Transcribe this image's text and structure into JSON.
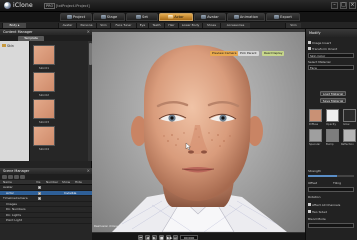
{
  "titlebar": {
    "app_name": "iClone",
    "edition": "PRO",
    "filename": "[txtProject.iProject]",
    "min": "–",
    "max": "□",
    "close": "×"
  },
  "main_tabs": [
    {
      "label": "Project",
      "active": false
    },
    {
      "label": "Stage",
      "active": false
    },
    {
      "label": "Set",
      "active": false
    },
    {
      "label": "Actor",
      "active": true
    },
    {
      "label": "Avatar",
      "active": false
    },
    {
      "label": "Animation",
      "active": false
    },
    {
      "label": "Export",
      "active": false
    }
  ],
  "sub_tabs": [
    "Body ▸",
    "Avatar",
    "Persona",
    "Skin",
    "Face Tuner",
    "Eye",
    "Teeth",
    "Hair",
    "Lower Body",
    "Shoes",
    "Accessories",
    "Skin"
  ],
  "content_manager": {
    "title": "Content Manager",
    "tab": "Template",
    "tree_item": "Skin",
    "items": [
      "Skin01",
      "Skin02",
      "Skin03",
      "Skin04"
    ]
  },
  "scene_manager": {
    "title": "Scene Manager",
    "columns": [
      "Name",
      "Vis",
      "Number",
      "Show",
      "Hide"
    ],
    "rows": [
      {
        "name": "Avatar",
        "value": "",
        "selected": false
      },
      {
        "name": "Actor",
        "value": "Invisible",
        "selected": true
      },
      {
        "name": "TimelineCamera",
        "value": "",
        "selected": false
      },
      {
        "name": "Images",
        "value": "",
        "selected": false
      },
      {
        "name": "Dir. Numbers",
        "value": "",
        "selected": false
      },
      {
        "name": "Dir. Lights",
        "value": "",
        "selected": false
      },
      {
        "name": "Point Light",
        "value": "",
        "selected": false
      }
    ]
  },
  "viewport": {
    "tools": [
      "Preview Camera",
      "Pick Parent",
      "Real Display"
    ],
    "note": "Reallusion iClone",
    "colors": {
      "tool_active": "#e9a94e",
      "tool_green": "#c7d78c"
    }
  },
  "playback": {
    "buttons": [
      "⏮",
      "◀",
      "▶",
      "■",
      "▶▶",
      "⏭"
    ],
    "frame": "00:000"
  },
  "modify_panel": {
    "title": "Modify",
    "fields": [
      "Image Insert",
      "Transform Orient",
      "Skin Color",
      "Select Material"
    ],
    "material": "Face",
    "buttons": [
      "Load Material",
      "Save Material"
    ],
    "swatches": [
      {
        "label": "Diffuse",
        "color": "#c99175"
      },
      {
        "label": "Opacity",
        "color": "#efefef"
      },
      {
        "label": "Specular",
        "color": "#9f9f9f"
      },
      {
        "label": "Bump",
        "color": "#7d7d7d"
      },
      {
        "label": "Reflection",
        "color": "#b6b6b6"
      },
      {
        "label": "Glow",
        "color": "#2a2a2a"
      }
    ],
    "strength_label": "Strength",
    "strength_value": 62,
    "settings": [
      "Offset",
      "Tiling",
      "Rotation",
      "Affect All Channels",
      "Two Sided",
      "Blend Mode"
    ]
  }
}
